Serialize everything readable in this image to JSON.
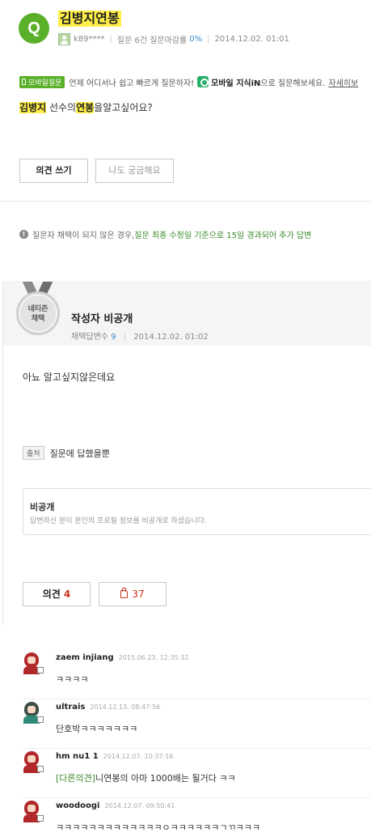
{
  "question": {
    "badge": "Q",
    "title": "김병지연봉",
    "author": "k89****",
    "stats_label": "질문 6건 질문마감률",
    "close_rate": "0%",
    "date": "2014.12.02. 01:01",
    "mobile_tag": "모바일질문",
    "mobile_text": "언제 어디서나 쉽고 빠르게 질문하자!",
    "kin_name": "모바일 지식iN",
    "kin_suffix": "으로 질문해보세요.",
    "detail_link": "자세히보",
    "body": {
      "hl1": "김병지",
      "t1": " 선수의",
      "hl2": "연봉",
      "t2": "을알고싶어요?"
    },
    "opinion_button": "의견 쓰기",
    "curious_button": "나도 궁금해요"
  },
  "notice": {
    "icon": "!",
    "text": "질문자 채택이 되지 않은 경우, ",
    "green_text": "질문 최종 수정일 기준으로 15일 경과되어 추가 답변"
  },
  "answer": {
    "medal": {
      "line1": "네티즌",
      "line2": "채택"
    },
    "name": "작성자 비공개",
    "adopt_label": "채택답변수",
    "adopt_count": "9",
    "date": "2014.12.02. 01:02",
    "text": "아뇨 알고싶지않은데요",
    "source_tag": "출처",
    "source_text": "질문에 답했을뿐",
    "private_title": "비공개",
    "private_desc": "답변하신 분이 본인의 프로필 정보를 비공개로 하셨습니다.",
    "opinion_label": "의견",
    "opinion_count": "4",
    "like_count": "37"
  },
  "comments": [
    {
      "user": "zaem injiang",
      "date": "2015.06.23. 12:35:32",
      "tag": "",
      "text": "ㅋㅋㅋㅋ"
    },
    {
      "user": "ultrais",
      "date": "2014.12.13. 08:47:56",
      "tag": "",
      "text": "단호박ㅋㅋㅋㅋㅋㅋㅋ"
    },
    {
      "user": "hm nu1 1",
      "date": "2014.12.07. 10:37:16",
      "tag": "[다른의견]",
      "text": "니연봉의 아마 1000배는 될거다 ㅋㅋ"
    },
    {
      "user": "woodoogi",
      "date": "2014.12.07. 09:50:41",
      "tag": "",
      "text": "ㅋㅋㅋㅋㅋㅋㅋㅋㅋㅋㅋㅋㅋㅇㅋㅋㅋㅋㅋㅋㄱㄲㅋㅋㅋ"
    }
  ],
  "colors": {
    "brand_green": "#5bb02a",
    "highlight": "#ffef48",
    "count_red": "#c8321e",
    "link_blue": "#3a8ccf"
  }
}
